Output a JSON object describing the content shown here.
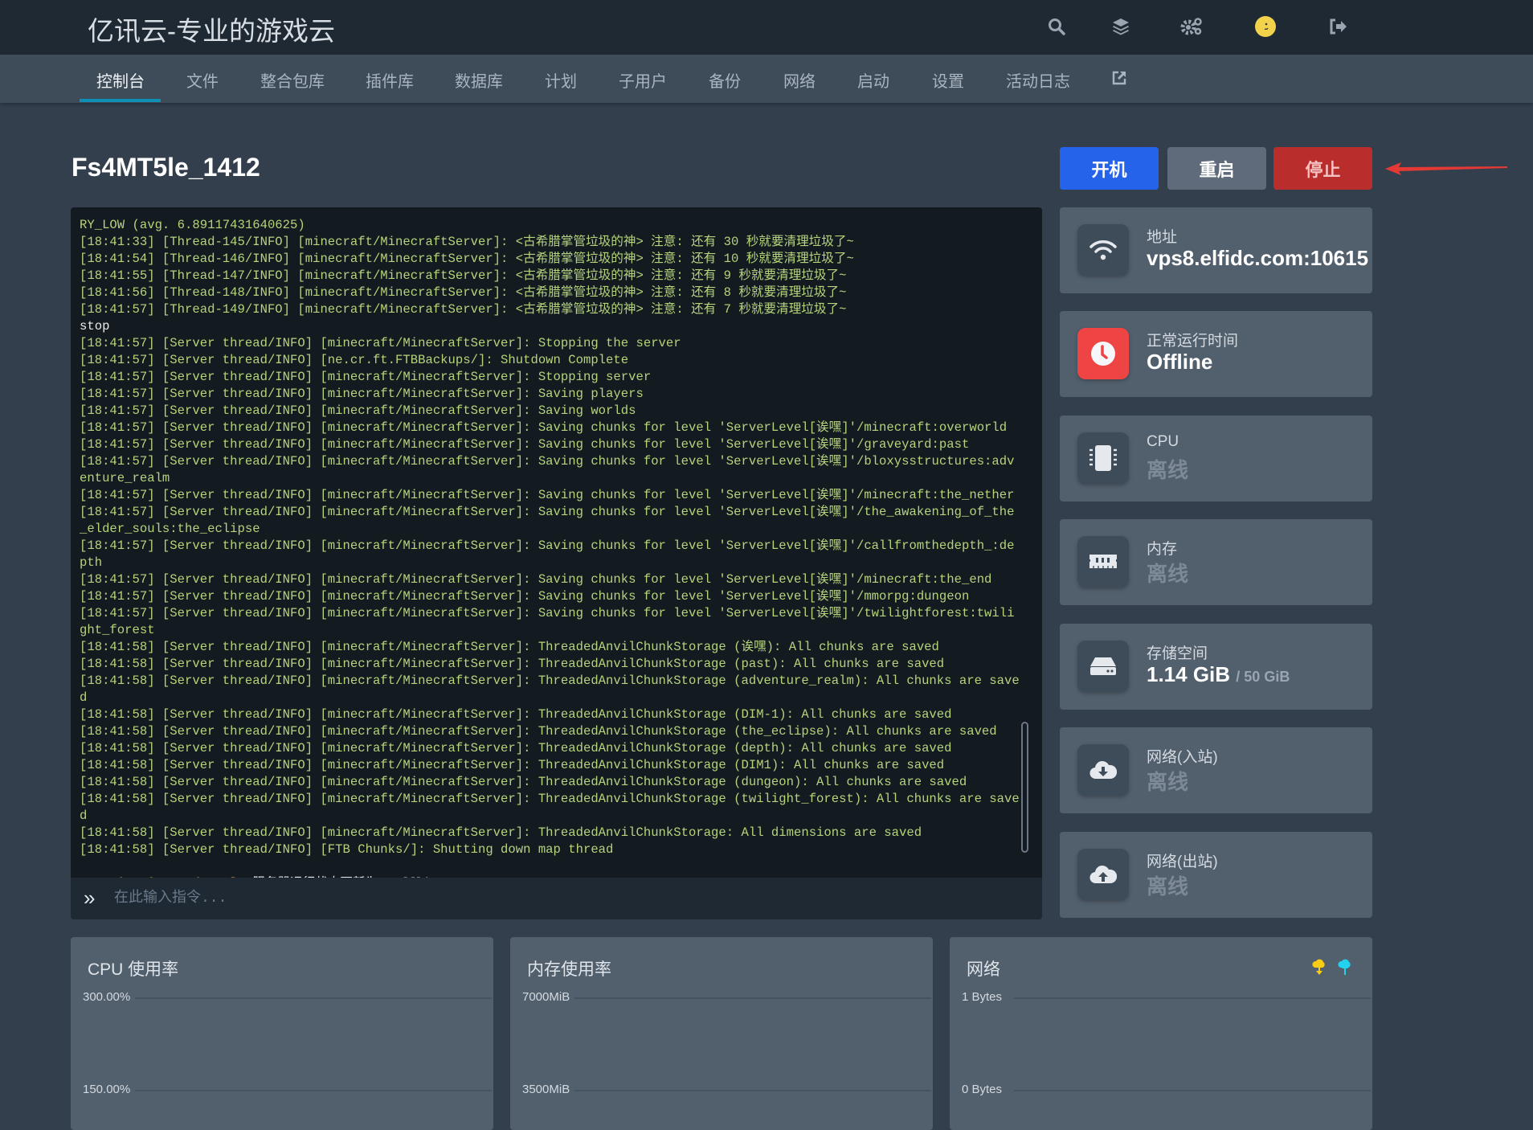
{
  "header": {
    "brand": "亿讯云-专业的游戏云",
    "icons": [
      "search-icon",
      "layers-icon",
      "gears-icon",
      "avatar-icon",
      "logout-icon"
    ]
  },
  "nav": {
    "tabs": [
      "控制台",
      "文件",
      "整合包库",
      "插件库",
      "数据库",
      "计划",
      "子用户",
      "备份",
      "网络",
      "启动",
      "设置",
      "活动日志"
    ],
    "active": "控制台",
    "external_icon": "external-link-icon"
  },
  "server": {
    "name": "Fs4MT5le_1412"
  },
  "power": {
    "start": "开机",
    "restart": "重启",
    "stop": "停止",
    "colors": {
      "start": "#2563eb",
      "restart": "#5f6b7a",
      "stop": "#b92d2d"
    }
  },
  "console": {
    "lines": [
      "RY_LOW (avg. 6.89117431640625)",
      "[18:41:33] [Thread-145/INFO] [minecraft/MinecraftServer]: <古希腊掌管垃圾的神> 注意: 还有 30 秒就要清理垃圾了~",
      "[18:41:54] [Thread-146/INFO] [minecraft/MinecraftServer]: <古希腊掌管垃圾的神> 注意: 还有 10 秒就要清理垃圾了~",
      "[18:41:55] [Thread-147/INFO] [minecraft/MinecraftServer]: <古希腊掌管垃圾的神> 注意: 还有 9 秒就要清理垃圾了~",
      "[18:41:56] [Thread-148/INFO] [minecraft/MinecraftServer]: <古希腊掌管垃圾的神> 注意: 还有 8 秒就要清理垃圾了~",
      "[18:41:57] [Thread-149/INFO] [minecraft/MinecraftServer]: <古希腊掌管垃圾的神> 注意: 还有 7 秒就要清理垃圾了~",
      "stop",
      "[18:41:57] [Server thread/INFO] [minecraft/MinecraftServer]: Stopping the server",
      "[18:41:57] [Server thread/INFO] [ne.cr.ft.FTBBackups/]: Shutdown Complete",
      "[18:41:57] [Server thread/INFO] [minecraft/MinecraftServer]: Stopping server",
      "[18:41:57] [Server thread/INFO] [minecraft/MinecraftServer]: Saving players",
      "[18:41:57] [Server thread/INFO] [minecraft/MinecraftServer]: Saving worlds",
      "[18:41:57] [Server thread/INFO] [minecraft/MinecraftServer]: Saving chunks for level 'ServerLevel[诶嘿]'/minecraft:overworld",
      "[18:41:57] [Server thread/INFO] [minecraft/MinecraftServer]: Saving chunks for level 'ServerLevel[诶嘿]'/graveyard:past",
      "[18:41:57] [Server thread/INFO] [minecraft/MinecraftServer]: Saving chunks for level 'ServerLevel[诶嘿]'/bloxysstructures:adventure_realm",
      "[18:41:57] [Server thread/INFO] [minecraft/MinecraftServer]: Saving chunks for level 'ServerLevel[诶嘿]'/minecraft:the_nether",
      "[18:41:57] [Server thread/INFO] [minecraft/MinecraftServer]: Saving chunks for level 'ServerLevel[诶嘿]'/the_awakening_of_the_elder_souls:the_eclipse",
      "[18:41:57] [Server thread/INFO] [minecraft/MinecraftServer]: Saving chunks for level 'ServerLevel[诶嘿]'/callfromthedepth_:depth",
      "[18:41:57] [Server thread/INFO] [minecraft/MinecraftServer]: Saving chunks for level 'ServerLevel[诶嘿]'/minecraft:the_end",
      "[18:41:57] [Server thread/INFO] [minecraft/MinecraftServer]: Saving chunks for level 'ServerLevel[诶嘿]'/mmorpg:dungeon",
      "[18:41:57] [Server thread/INFO] [minecraft/MinecraftServer]: Saving chunks for level 'ServerLevel[诶嘿]'/twilightforest:twilight_forest",
      "[18:41:58] [Server thread/INFO] [minecraft/MinecraftServer]: ThreadedAnvilChunkStorage (诶嘿): All chunks are saved",
      "[18:41:58] [Server thread/INFO] [minecraft/MinecraftServer]: ThreadedAnvilChunkStorage (past): All chunks are saved",
      "[18:41:58] [Server thread/INFO] [minecraft/MinecraftServer]: ThreadedAnvilChunkStorage (adventure_realm): All chunks are saved",
      "[18:41:58] [Server thread/INFO] [minecraft/MinecraftServer]: ThreadedAnvilChunkStorage (DIM-1): All chunks are saved",
      "[18:41:58] [Server thread/INFO] [minecraft/MinecraftServer]: ThreadedAnvilChunkStorage (the_eclipse): All chunks are saved",
      "[18:41:58] [Server thread/INFO] [minecraft/MinecraftServer]: ThreadedAnvilChunkStorage (depth): All chunks are saved",
      "[18:41:58] [Server thread/INFO] [minecraft/MinecraftServer]: ThreadedAnvilChunkStorage (DIM1): All chunks are saved",
      "[18:41:58] [Server thread/INFO] [minecraft/MinecraftServer]: ThreadedAnvilChunkStorage (dungeon): All chunks are saved",
      "[18:41:58] [Server thread/INFO] [minecraft/MinecraftServer]: ThreadedAnvilChunkStorage (twilight_forest): All chunks are saved",
      "[18:41:58] [Server thread/INFO] [minecraft/MinecraftServer]: ThreadedAnvilChunkStorage: All dimensions are saved",
      "[18:41:58] [Server thread/INFO] [FTB Chunks/]: Shutting down map thread"
    ],
    "prompt": "container@pterodactyl~",
    "status_message": " 服务器运行状态更新为: offline...",
    "input_placeholder": "在此输入指令..."
  },
  "stats": [
    {
      "label": "地址",
      "value": "vps8.elfidc.com:10615",
      "icon": "wifi-icon"
    },
    {
      "label": "正常运行时间",
      "value": "Offline",
      "icon": "clock-icon",
      "accent": "#ef4444"
    },
    {
      "label": "CPU",
      "value": "离线",
      "icon": "microchip-icon"
    },
    {
      "label": "内存",
      "value": "离线",
      "icon": "memory-icon"
    },
    {
      "label": "存储空间",
      "value": "1.14 GiB",
      "limit": "/ 50 GiB",
      "icon": "hdd-icon"
    },
    {
      "label": "网络(入站)",
      "value": "离线",
      "icon": "cloud-download-icon"
    },
    {
      "label": "网络(出站)",
      "value": "离线",
      "icon": "cloud-upload-icon"
    }
  ],
  "charts": [
    {
      "title": "CPU 使用率",
      "ticks": [
        "300.00%",
        "150.00%"
      ]
    },
    {
      "title": "内存使用率",
      "ticks": [
        "7000MiB",
        "3500MiB"
      ]
    },
    {
      "title": "网络",
      "ticks": [
        "1 Bytes",
        "0 Bytes"
      ],
      "legend_colors": [
        "#facc15",
        "#22d3ee"
      ]
    }
  ]
}
